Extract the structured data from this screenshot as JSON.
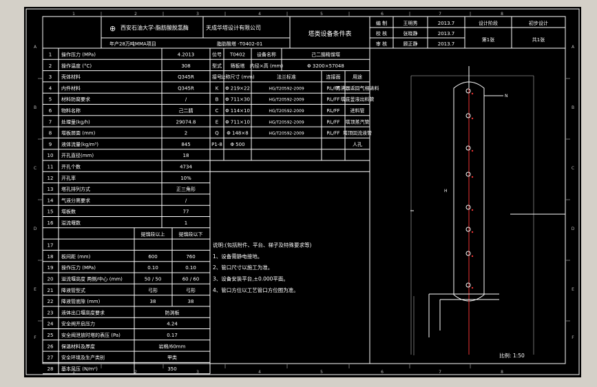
{
  "header": {
    "university": "西安石油大学-脂肪酸脱氢酶",
    "company": "天成华塔设计有限公司",
    "drawing_title": "年产28万吨MMA项目",
    "drawing_code": "脂肪酸塔 -T0402-01",
    "sheet_title": "塔类设备条件表",
    "sign_rows": [
      {
        "role": "编 制",
        "name": "王明秀",
        "date": "2013.7"
      },
      {
        "role": "校 核",
        "name": "张晓静",
        "date": "2013.7"
      },
      {
        "role": "审 核",
        "name": "顾正静",
        "date": "2013.7"
      }
    ],
    "stage_label": "设计阶段",
    "stage_value": "初步设计",
    "sheet_no": "第1张",
    "sheet_total": "共1张"
  },
  "ruler": {
    "top": [
      "1",
      "2",
      "3",
      "4",
      "5",
      "6",
      "7",
      "8"
    ],
    "side": [
      "A",
      "B",
      "C",
      "D",
      "E",
      "F"
    ]
  },
  "params": [
    {
      "no": "1",
      "label": "操作压力 (MPa)",
      "value": "4.2013"
    },
    {
      "no": "2",
      "label": "操作温度 (°C)",
      "value": "308"
    },
    {
      "no": "3",
      "label": "壳体材料",
      "value": "Q345R"
    },
    {
      "no": "4",
      "label": "内件材料",
      "value": "Q345R"
    },
    {
      "no": "5",
      "label": "材料防腐要求",
      "value": "/"
    },
    {
      "no": "6",
      "label": "物料名称",
      "value": "己二腈"
    },
    {
      "no": "7",
      "label": "处理量(kg/h)",
      "value": "29074.8"
    },
    {
      "no": "8",
      "label": "塔板层面 (mm)",
      "value": "2"
    },
    {
      "no": "9",
      "label": "液体流量(kg/m³)",
      "value": "845"
    },
    {
      "no": "10",
      "label": "开孔直径(mm)",
      "value": "18"
    },
    {
      "no": "11",
      "label": "开孔个数",
      "value": "4734"
    },
    {
      "no": "12",
      "label": "开孔率",
      "value": "10%"
    },
    {
      "no": "13",
      "label": "塔孔排列方式",
      "value": "正三角形"
    },
    {
      "no": "14",
      "label": "气液分离要求",
      "value": "/"
    },
    {
      "no": "15",
      "label": "塔板数",
      "value": "77"
    },
    {
      "no": "16",
      "label": "溢流堰数",
      "value": "1"
    }
  ],
  "nozzle": {
    "rows": [
      {
        "a": "位号",
        "b": "T0402",
        "c": "设备名称",
        "d": "己二腈精馏塔"
      },
      {
        "a": "型式",
        "b": "筛板塔",
        "c": "内径×高 (mm)",
        "d": "Φ 3200×57048"
      }
    ],
    "headers": [
      "接号",
      "公称尺寸 (mm)",
      "法兰标准",
      "连接面",
      "用途"
    ],
    "items": [
      {
        "id": "K",
        "size": "Φ 219×22",
        "std": "HG/T20592-2009",
        "face": "RL/FF",
        "use": "再沸器返回气相进料"
      },
      {
        "id": "B",
        "size": "Φ 711×30",
        "std": "HG/T20592-2009",
        "face": "RL/FF",
        "use": "塔底釜液出料管"
      },
      {
        "id": "C",
        "size": "Φ 114×10",
        "std": "HG/T20592-2009",
        "face": "RL/FF",
        "use": "进料管"
      },
      {
        "id": "E",
        "size": "Φ 711×10",
        "std": "HG/T20592-2009",
        "face": "RL/FF",
        "use": "塔顶蒸汽管"
      },
      {
        "id": "Q",
        "size": "Φ 148×8",
        "std": "HG/T20592-2009",
        "face": "RL/FF",
        "use": "塔顶回流液管"
      },
      {
        "id": "P1-8",
        "size": "Φ 500",
        "std": "",
        "face": "",
        "use": "人孔"
      }
    ]
  },
  "lower": {
    "zone_headers": [
      "",
      "提馏段以上",
      "提馏段以下"
    ],
    "rows": [
      {
        "no": "17",
        "label": "",
        "a": "",
        "b": ""
      },
      {
        "no": "18",
        "label": "板间距 (mm)",
        "a": "600",
        "b": "760"
      },
      {
        "no": "19",
        "label": "操作压力 (MPa)",
        "a": "0.10",
        "b": "0.10"
      },
      {
        "no": "20",
        "label": "溢流堰高度 两侧/中心 (mm)",
        "a": "50 / 50",
        "b": "60 / 60"
      },
      {
        "no": "21",
        "label": "降液管型式",
        "a": "弓形",
        "b": "弓形"
      },
      {
        "no": "22",
        "label": "降液管底隙 (mm)",
        "a": "38",
        "b": "38"
      },
      {
        "no": "23",
        "label": "液体出口堰高度要求",
        "a": "防涡板",
        "b": ""
      },
      {
        "no": "24",
        "label": "安全阀开启压力",
        "a": "4.24",
        "b": ""
      },
      {
        "no": "25",
        "label": "安全阀泄放时塔的表压 (Pa)",
        "a": "0.17",
        "b": ""
      },
      {
        "no": "26",
        "label": "保温材料及厚度",
        "a": "岩棉/60mm",
        "b": ""
      },
      {
        "no": "27",
        "label": "安全环境及生产类别",
        "a": "甲类",
        "b": ""
      },
      {
        "no": "28",
        "label": "基本风压 (N/m²)",
        "a": "350",
        "b": ""
      }
    ]
  },
  "notes": {
    "title": "说明:(包括附件、平台、梯子及特殊要求等)",
    "items": [
      "1、设备需静电接地。",
      "2、管口尺寸以施工为准。",
      "3、设备安装平台,±0.000平面。",
      "4、管口方位以工艺管口方位图为准。"
    ]
  },
  "elevation": {
    "nozzle_labels": [
      "N",
      "H"
    ],
    "scale_label": "比例: 1:50"
  }
}
